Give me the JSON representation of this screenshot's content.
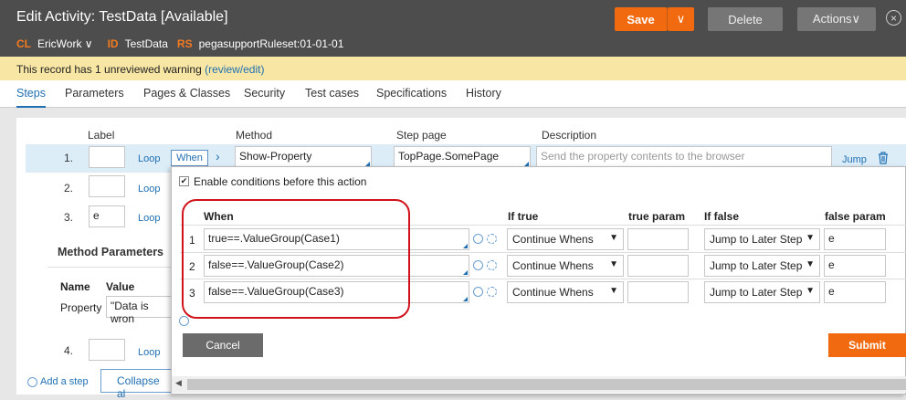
{
  "header": {
    "title": "Edit Activity: TestData [Available]",
    "save": "Save",
    "save_caret": "∨",
    "delete": "Delete",
    "actions": "Actions∨",
    "close": "×",
    "meta": {
      "cl_tag": "CL",
      "cl_value": "EricWork ∨",
      "id_tag": "ID",
      "id_value": "TestData",
      "rs_tag": "RS",
      "rs_value": "pegasupportRuleset:01-01-01"
    }
  },
  "warning": {
    "text": "This record has 1 unreviewed warning ",
    "link": "(review/edit)"
  },
  "tabs": [
    "Steps",
    "Parameters",
    "Pages & Classes",
    "Security",
    "Test cases",
    "Specifications",
    "History"
  ],
  "steps": {
    "headers": {
      "label": "Label",
      "method": "Method",
      "step_page": "Step page",
      "description": "Description"
    },
    "rows": [
      {
        "num": "1.",
        "label": "",
        "loop": "Loop",
        "when": "When",
        "method": "Show-Property",
        "step_page": "TopPage.SomePage",
        "description_placeholder": "Send the property contents to the browser",
        "jump": "Jump"
      },
      {
        "num": "2.",
        "label": "",
        "loop": "Loop"
      },
      {
        "num": "3.",
        "label": "e",
        "loop": "Loop"
      },
      {
        "num": "4.",
        "label": "",
        "loop": "Loop"
      }
    ],
    "method_params_title": "Method Parameters",
    "param_name_head": "Name",
    "param_value_head": "Value",
    "param_name": "Property",
    "param_value": "\"Data is wron",
    "add_step": "Add a step",
    "collapse": "Collapse al"
  },
  "popup": {
    "enable_label": "Enable conditions before this action",
    "headers": {
      "when": "When",
      "if_true": "If true",
      "true_param": "true param",
      "if_false": "If false",
      "false_param": "false param"
    },
    "rows": [
      {
        "num": "1",
        "when": "true==.ValueGroup(Case1)",
        "if_true": "Continue Whens",
        "true_param": "",
        "if_false": "Jump to Later Step",
        "false_param": "e"
      },
      {
        "num": "2",
        "when": "false==.ValueGroup(Case2)",
        "if_true": "Continue Whens",
        "true_param": "",
        "if_false": "Jump to Later Step",
        "false_param": "e"
      },
      {
        "num": "3",
        "when": "false==.ValueGroup(Case3)",
        "if_true": "Continue Whens",
        "true_param": "",
        "if_false": "Jump to Later Step",
        "false_param": "e"
      }
    ],
    "cancel": "Cancel",
    "submit": "Submit"
  }
}
